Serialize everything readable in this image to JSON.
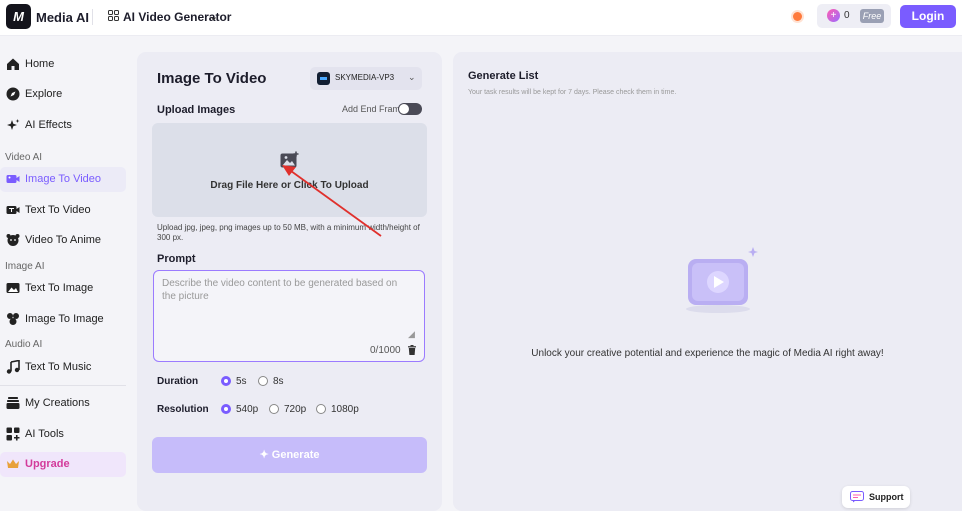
{
  "topbar": {
    "logo_text": "M",
    "brand": "Media AI",
    "generator_title": "AI Video Generator",
    "credits": "0",
    "free_badge": "Free",
    "login_label": "Login"
  },
  "sidebar": {
    "home": "Home",
    "explore": "Explore",
    "ai_effects": "AI Effects",
    "section_video": "Video AI",
    "image_to_video": "Image To Video",
    "text_to_video": "Text To Video",
    "video_to_anime": "Video To Anime",
    "section_image": "Image AI",
    "text_to_image": "Text To Image",
    "image_to_image": "Image To Image",
    "section_audio": "Audio AI",
    "text_to_music": "Text To Music",
    "my_creations": "My Creations",
    "ai_tools": "AI Tools",
    "upgrade": "Upgrade"
  },
  "form": {
    "title": "Image To Video",
    "model": "SKYMEDIA-VP3",
    "upload_label": "Upload Images",
    "end_frame_label": "Add End Frame",
    "upload_text": "Drag File Here or Click To Upload",
    "upload_hint": "Upload jpg, jpeg, png images up to 50 MB, with a minimum width/height of 300 px.",
    "prompt_label": "Prompt",
    "prompt_placeholder": "Describe the video content to be generated based on the picture",
    "char_count": "0/1000",
    "duration_label": "Duration",
    "duration_options": [
      "5s",
      "8s"
    ],
    "duration_selected": "5s",
    "resolution_label": "Resolution",
    "resolution_options": [
      "540p",
      "720p",
      "1080p"
    ],
    "resolution_selected": "540p",
    "generate_label": "Generate"
  },
  "generate_list": {
    "title": "Generate List",
    "note": "Your task results will be kept for 7 days. Please check them in time.",
    "empty_text": "Unlock your creative potential and experience the magic of Media AI right away!"
  },
  "support_label": "Support",
  "colors": {
    "accent": "#7a5cff",
    "generate_disabled": "#c6bcfa",
    "upgrade_text": "#d33b9b",
    "annotation_arrow": "#e0302c"
  }
}
